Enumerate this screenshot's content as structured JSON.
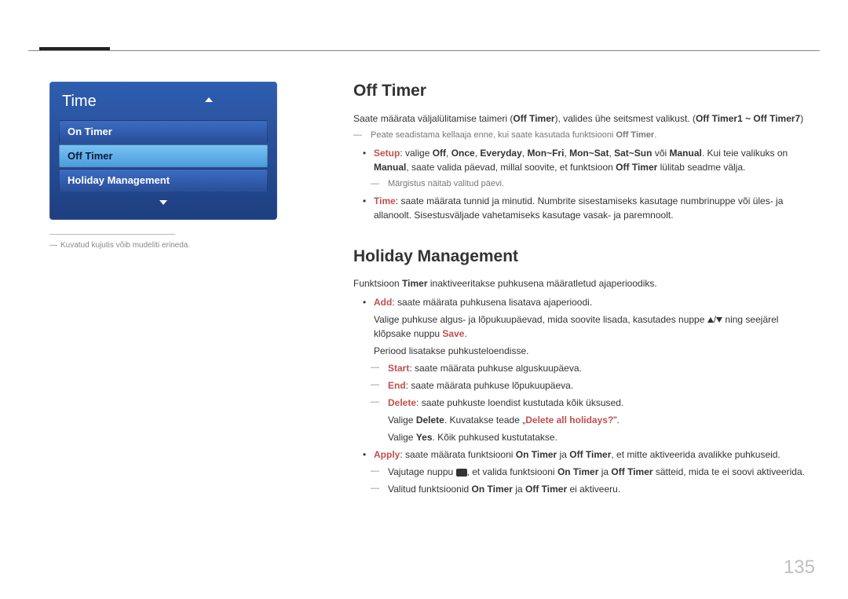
{
  "menu": {
    "title": "Time",
    "items": [
      "On Timer",
      "Off Timer",
      "Holiday Management"
    ],
    "selected_index": 1
  },
  "caption": "Kuvatud kujutis võib mudeliti erineda.",
  "off_timer": {
    "heading": "Off Timer",
    "intro_pre": "Saate määrata väljalülitamise taimeri (",
    "intro_bold1": "Off Timer",
    "intro_mid": "), valides ühe seitsmest valikust. (",
    "intro_bold2": "Off Timer1 ~ Off Timer7",
    "intro_post": ")",
    "note_pre": "Peate seadistama kellaaja enne, kui saate kasutada funktsiooni ",
    "note_bold": "Off Timer",
    "setup": {
      "label": "Setup",
      "text1": ": valige ",
      "opts": [
        "Off",
        "Once",
        "Everyday",
        "Mon~Fri",
        "Mon~Sat",
        "Sat~Sun"
      ],
      "or": " või ",
      "manual": "Manual",
      "text2": ". Kui teie valikuks on ",
      "text3": ", saate valida päevad, millal soovite, et funktsioon ",
      "off_timer": "Off Timer",
      "text4": " lülitab seadme välja.",
      "note": "Märgistus näitab valitud päevi."
    },
    "time": {
      "label": "Time",
      "text": ": saate määrata tunnid ja minutid. Numbrite sisestamiseks kasutage numbrinuppe või üles- ja allanoolt. Sisestusväljade vahetamiseks kasutage vasak- ja paremnoolt."
    }
  },
  "holiday_mgmt": {
    "heading": "Holiday Management",
    "intro_pre": "Funktsioon ",
    "intro_bold": "Timer",
    "intro_post": " inaktiveeritakse puhkusena määratletud ajaperioodiks.",
    "add": {
      "label": "Add",
      "text1": ": saate määrata puhkusena lisatava ajaperioodi.",
      "text2_pre": "Valige puhkuse algus- ja lõpukuupäevad, mida soovite lisada, kasutades nuppe ",
      "text2_post": " ning seejärel klõpsake nuppu ",
      "save": "Save",
      "period": "Periood lisatakse puhkusteloendisse.",
      "start_label": "Start",
      "start_text": ": saate määrata puhkuse alguskuupäeva.",
      "end_label": "End",
      "end_text": ": saate määrata puhkuse lõpukuupäeva.",
      "delete_label": "Delete",
      "delete_text": ": saate puhkuste loendist kustutada kõik üksused.",
      "delete_line_pre": "Valige ",
      "delete_bold": "Delete",
      "delete_line_mid": ". Kuvatakse teade „",
      "delete_q": "Delete all holidays?",
      "delete_line_post": "\".",
      "yes_pre": "Valige ",
      "yes": "Yes",
      "yes_post": ". Kõik puhkused kustutatakse."
    },
    "apply": {
      "label": "Apply",
      "text_pre": ": saate määrata funktsiooni ",
      "on_timer": "On Timer",
      "and": " ja ",
      "off_timer": "Off Timer",
      "text_post": ", et mitte aktiveerida avalikke puhkuseid.",
      "press_pre": "Vajutage nuppu ",
      "press_mid": ", et valida funktsiooni ",
      "press_post": " sätteid, mida te ei soovi aktiveerida.",
      "selected_pre": "Valitud funktsioonid ",
      "selected_post": " ei aktiveeru."
    }
  },
  "page_number": "135"
}
